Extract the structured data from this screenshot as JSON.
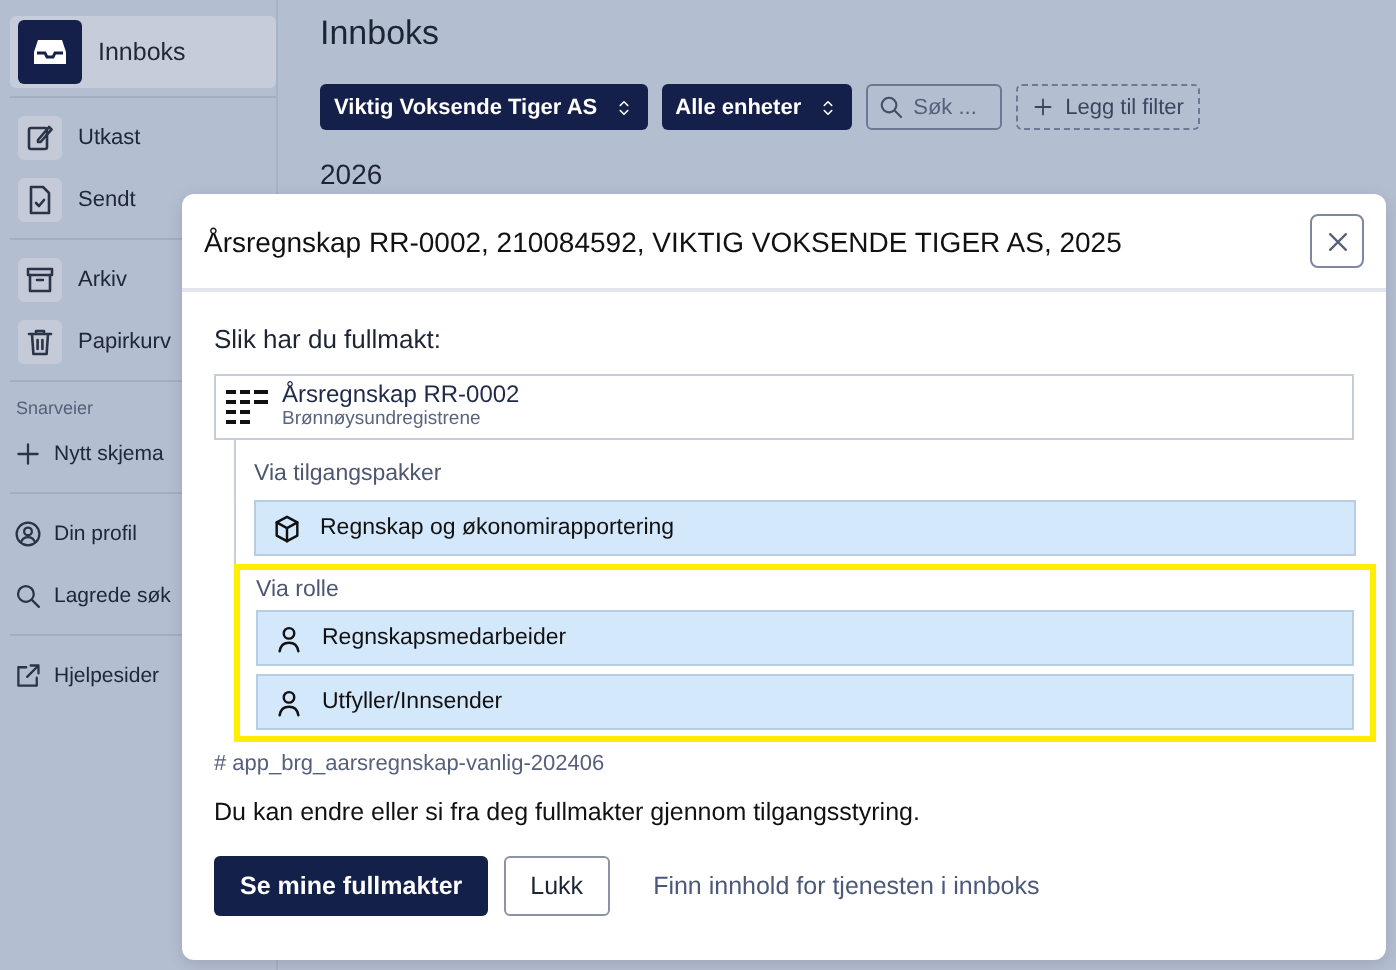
{
  "sidebar": {
    "groups": [
      {
        "items": [
          {
            "label": "Innboks",
            "selected": true
          }
        ]
      },
      {
        "items": [
          {
            "label": "Utkast",
            "selected": false
          },
          {
            "label": "Sendt",
            "selected": false
          }
        ]
      },
      {
        "items": [
          {
            "label": "Arkiv",
            "selected": false
          },
          {
            "label": "Papirkurv",
            "selected": false
          }
        ]
      },
      {
        "heading": "Snarveier",
        "items": [
          {
            "label": "Nytt skjema",
            "selected": false
          }
        ]
      },
      {
        "items": [
          {
            "label": "Din profil",
            "selected": false
          },
          {
            "label": "Lagrede søk",
            "selected": false
          }
        ]
      },
      {
        "items": [
          {
            "label": "Hjelpesider",
            "selected": false
          }
        ]
      }
    ]
  },
  "main": {
    "title": "Innboks",
    "filters": [
      {
        "label": "Viktig Voksende Tiger AS"
      },
      {
        "label": "Alle enheter"
      }
    ],
    "search": {
      "placeholder": "Søk ..."
    },
    "add_filter": "Legg til filter",
    "year": "2026"
  },
  "dialog": {
    "title": "Årsregnskap RR-0002, 210084592, VIKTIG VOKSENDE TIGER AS, 2025",
    "intro": "Slik har du fullmakt:",
    "service": {
      "name": "Årsregnskap RR-0002",
      "owner": "Brønnøysundregistrene"
    },
    "groups": [
      {
        "label": "Via tilgangspakker",
        "highlighted": false,
        "items": [
          {
            "label": "Regnskap og økonomirapportering",
            "kind": "package"
          }
        ]
      },
      {
        "label": "Via rolle",
        "highlighted": true,
        "items": [
          {
            "label": "Regnskapsmedarbeider",
            "kind": "role"
          },
          {
            "label": "Utfyller/Innsender",
            "kind": "role"
          }
        ]
      }
    ],
    "resource_id": "# app_brg_aarsregnskap-vanlig-202406",
    "note": "Du kan endre eller si fra deg fullmakter gjennom tilgangsstyring.",
    "primary_button": "Se mine fullmakter",
    "secondary_button": "Lukk",
    "link": "Finn innhold for tjenesten i innboks"
  }
}
